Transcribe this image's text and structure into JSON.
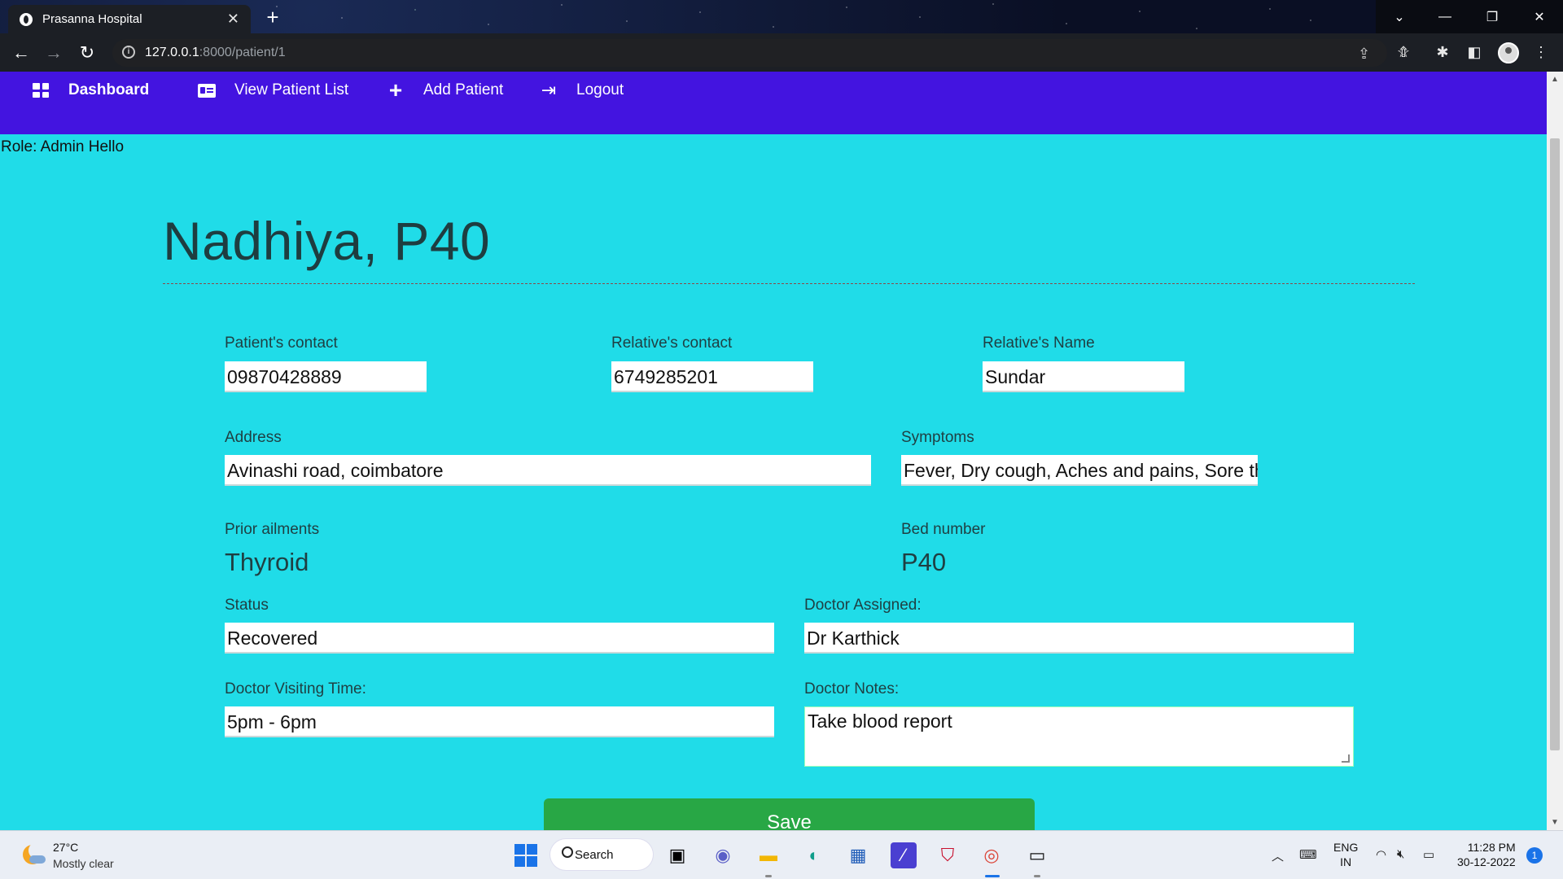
{
  "browser": {
    "tab_title": "Prasanna Hospital",
    "url_host": "127.0.0.1",
    "url_rest": ":8000/patient/1"
  },
  "nav": {
    "items": [
      {
        "label": "Dashboard",
        "icon": "dashboard-grid-icon"
      },
      {
        "label": "View Patient List",
        "icon": "id-card-icon"
      },
      {
        "label": "Add Patient",
        "icon": "plus-icon"
      },
      {
        "label": "Logout",
        "icon": "logout-icon"
      }
    ]
  },
  "role_text": "Role: Admin Hello",
  "patient": {
    "heading": "Nadhiya, P40",
    "patient_contact_label": "Patient's contact",
    "patient_contact": "09870428889",
    "relative_contact_label": "Relative's contact",
    "relative_contact": "6749285201",
    "relative_name_label": "Relative's Name",
    "relative_name": "Sundar",
    "address_label": "Address",
    "address": "Avinashi road, coimbatore",
    "symptoms_label": "Symptoms",
    "symptoms": "Fever, Dry cough, Aches and pains, Sore thro",
    "prior_ailments_label": "Prior ailments",
    "prior_ailments": "Thyroid",
    "bed_number_label": "Bed number",
    "bed_number": "P40",
    "status_label": "Status",
    "status": "Recovered",
    "doctor_label": "Doctor Assigned:",
    "doctor": "Dr Karthick",
    "visiting_label": "Doctor Visiting Time:",
    "visiting_time": "5pm - 6pm",
    "notes_label": "Doctor Notes:",
    "notes": "Take blood report",
    "save_label": "Save"
  },
  "taskbar": {
    "temperature": "27°C",
    "weather": "Mostly clear",
    "search_label": "Search",
    "lang_line1": "ENG",
    "lang_line2": "IN",
    "time": "11:28 PM",
    "date": "30-12-2022",
    "notification_count": "1"
  },
  "colors": {
    "navbar": "#4314e0",
    "page_background": "#20dce8",
    "save_button": "#28a745"
  }
}
